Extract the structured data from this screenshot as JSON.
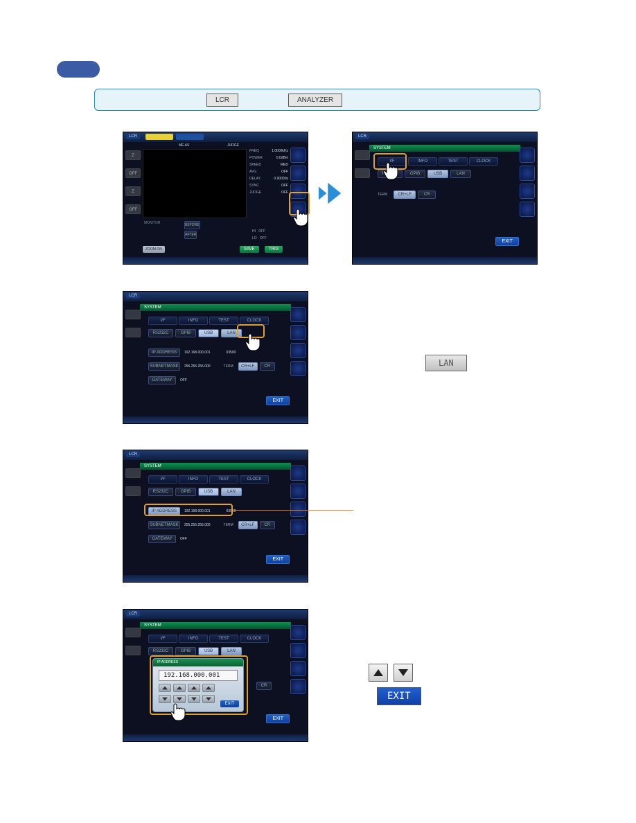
{
  "pill": {},
  "banner": {
    "btn1": "LCR",
    "btn2": "ANALYZER"
  },
  "shot1": {
    "lcr": "LCR",
    "meas": "ME AS",
    "judge": "JUDGE",
    "z1": "Z",
    "off1": "OFF",
    "z2": "Z",
    "off2": "OFF",
    "r": [
      {
        "k": "FREQ",
        "v": "1.0000kHz"
      },
      {
        "k": "POWER",
        "v": "0.0dBm"
      },
      {
        "k": "SPEED",
        "v": "MED"
      },
      {
        "k": "AVG",
        "v": "OFF"
      },
      {
        "k": "DELAY",
        "v": "0.00000s"
      },
      {
        "k": "SYNC",
        "v": "OFF"
      },
      {
        "k": "JUDGE",
        "v": "OFF"
      }
    ],
    "monitor": "MONITOR",
    "before": "BEFORE",
    "after": "AFTER",
    "hi": "HI   OFF",
    "lo": "LO   OFF",
    "zoom": "ZOOM ON",
    "save": "SAVE",
    "trig": "TRIG"
  },
  "shot2": {
    "lcr": "LCR",
    "system": "SYSTEM",
    "tabs": [
      "I/F",
      "INFO",
      "TEST",
      "CLOCK"
    ],
    "if": [
      "RS232C",
      "GPIB",
      "USB",
      "LAN"
    ],
    "term": "TERM",
    "crlf": "CR+LF",
    "cr": "CR",
    "exit": "EXIT"
  },
  "shot3": {
    "lcr": "LCR",
    "system": "SYSTEM",
    "tabs": [
      "I/F",
      "INFO",
      "TEST",
      "CLOCK"
    ],
    "if": [
      "RS232C",
      "GPIB",
      "USB",
      "LAN"
    ],
    "ipL": "IP ADDRESS",
    "ipV": "192.168.000.001",
    "port": "03500",
    "subL": "SUBNETMASK",
    "subV": "255.255.255.000",
    "term": "TERM",
    "crlf": "CR+LF",
    "cr": "CR",
    "gwL": "GATEWAY",
    "gwV": "OFF",
    "exit": "EXIT"
  },
  "lanBtn": "LAN",
  "shot4": {
    "lcr": "LCR",
    "system": "SYSTEM",
    "tabs": [
      "I/F",
      "INFO",
      "TEST",
      "CLOCK"
    ],
    "if": [
      "RS232C",
      "GPIB",
      "USB",
      "LAN"
    ],
    "ipL": "IP ADDRESS",
    "ipV": "192.168.000.001",
    "port": "03500",
    "subL": "SUBNETMASK",
    "subV": "255.255.255.000",
    "term": "TERM",
    "crlf": "CR+LF",
    "cr": "CR",
    "gwL": "GATEWAY",
    "gwV": "OFF",
    "exit": "EXIT"
  },
  "shot5": {
    "lcr": "LCR",
    "system": "SYSTEM",
    "tabs": [
      "I/F",
      "INFO",
      "TEST",
      "CLOCK"
    ],
    "if": [
      "RS232C",
      "GPIB",
      "USB",
      "LAN"
    ],
    "ipPanelHdr": "IP  ADDRESS",
    "ipPanelVal": "192.168.000.001",
    "exit": "EXIT",
    "cr": "CR",
    "ipExit": "EXIT"
  },
  "exitLg": "EXIT"
}
